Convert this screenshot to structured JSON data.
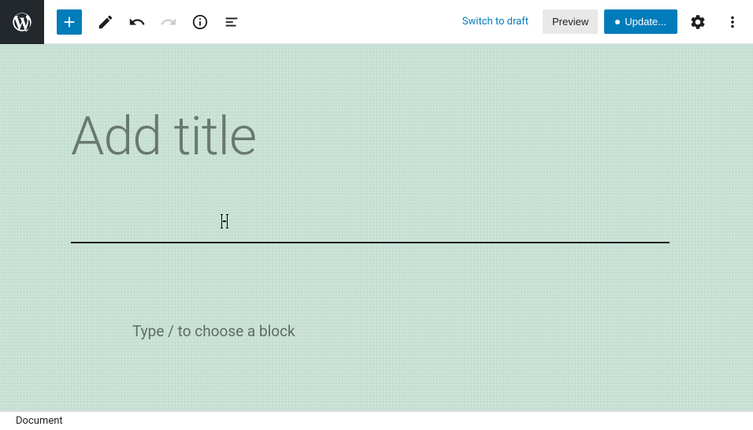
{
  "toolbar": {
    "switch_to_draft": "Switch to draft",
    "preview": "Preview",
    "update": "Update..."
  },
  "editor": {
    "title_placeholder": "Add title",
    "title_value": "",
    "block_placeholder": "Type / to choose a block"
  },
  "footer": {
    "breadcrumb": "Document"
  }
}
